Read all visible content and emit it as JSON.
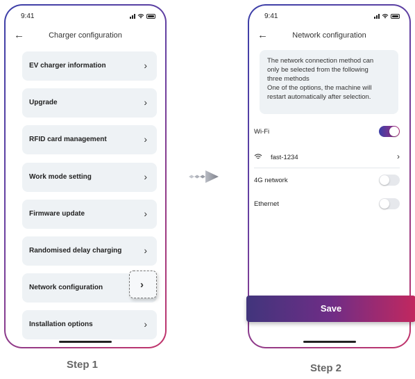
{
  "step1": {
    "time": "9:41",
    "title": "Charger configuration",
    "menu": [
      {
        "label": "EV charger information"
      },
      {
        "label": "Upgrade"
      },
      {
        "label": "RFID card management"
      },
      {
        "label": "Work mode setting"
      },
      {
        "label": "Firmware update"
      },
      {
        "label": "Randomised delay charging"
      },
      {
        "label": "Network configuration",
        "highlighted": true
      },
      {
        "label": "Installation options"
      }
    ],
    "caption": "Step 1"
  },
  "step2": {
    "time": "9:41",
    "title": "Network configuration",
    "info_lines": [
      "The network connection method can",
      "only be selected from the following",
      "three methods",
      "One of the options, the machine will",
      "restart automatically after selection."
    ],
    "wifi": {
      "label": "Wi-Fi",
      "on": true,
      "network": "fast-1234"
    },
    "g4": {
      "label": "4G network",
      "on": false
    },
    "ethernet": {
      "label": "Ethernet",
      "on": false
    },
    "save_label": "Save",
    "caption": "Step 2"
  },
  "colors": {
    "gradient_start": "#3b3fa8",
    "gradient_end": "#c2346a",
    "card_bg": "#eef2f5"
  },
  "icons": {
    "back": "arrow-left-icon",
    "chevron": "chevron-right-icon",
    "wifi": "wifi-icon",
    "flow": "arrow-right-icon"
  }
}
